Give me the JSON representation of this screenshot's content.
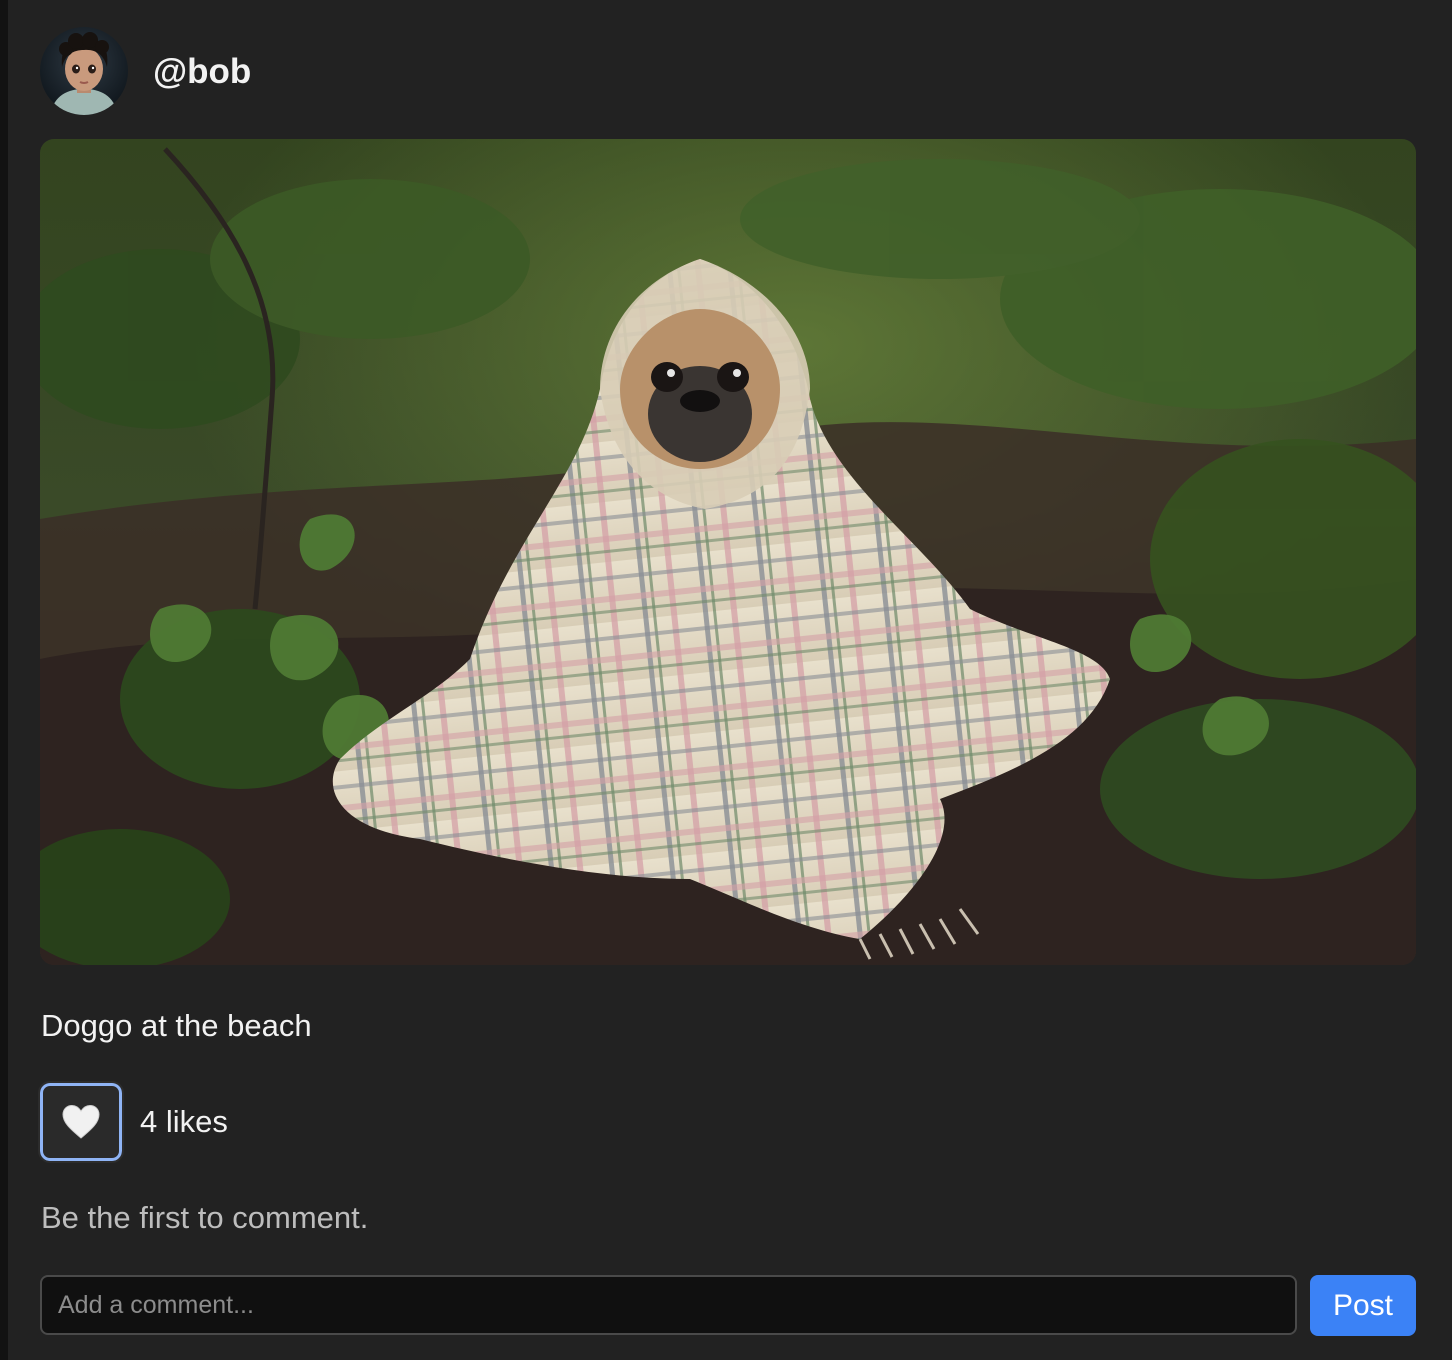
{
  "post": {
    "author": {
      "username": "@bob",
      "avatar": "toddler-portrait-avatar"
    },
    "image": "pug-wrapped-in-plaid-blanket-on-forest-path",
    "caption": "Doggo at the beach",
    "likes": {
      "button_icon": "white-heart-icon",
      "count_label": "4 likes",
      "liked": false
    },
    "comments": {
      "empty_message": "Be the first to comment."
    },
    "comment_form": {
      "placeholder": "Add a comment...",
      "value": "",
      "submit_label": "Post"
    }
  },
  "colors": {
    "card_background": "#222222",
    "page_background": "#121212",
    "primary_text": "#f2f2f2",
    "muted_text": "#bdbdbd",
    "accent": "#3b82f6",
    "focus_ring": "#8fb4f5",
    "input_background": "#101010"
  }
}
